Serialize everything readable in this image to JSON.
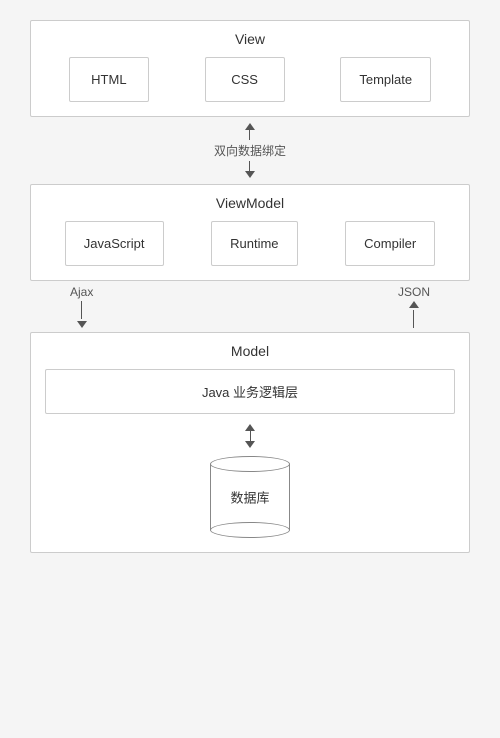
{
  "view": {
    "title": "View",
    "items": [
      {
        "label": "HTML"
      },
      {
        "label": "CSS"
      },
      {
        "label": "Template"
      }
    ]
  },
  "connector1": {
    "label": "双向数据绑定"
  },
  "viewmodel": {
    "title": "ViewModel",
    "items": [
      {
        "label": "JavaScript"
      },
      {
        "label": "Runtime"
      },
      {
        "label": "Compiler"
      }
    ]
  },
  "connector2": {
    "left_label": "Ajax",
    "right_label": "JSON"
  },
  "model": {
    "title": "Model",
    "java_label": "Java 业务逻辑层",
    "db_label": "数据库"
  }
}
